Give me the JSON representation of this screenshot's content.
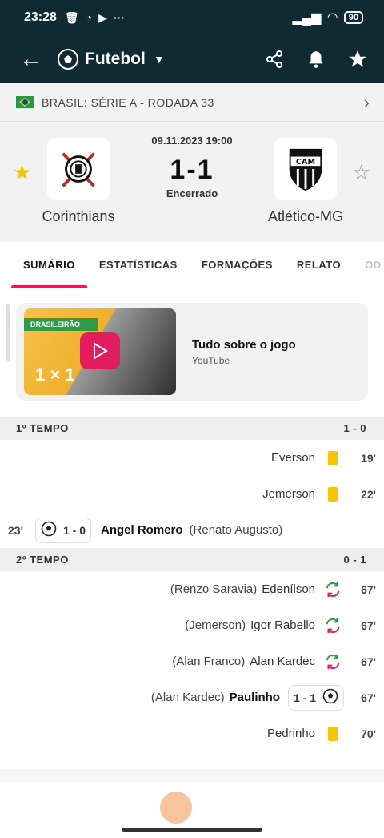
{
  "status": {
    "time": "23:28",
    "battery": "90"
  },
  "appbar": {
    "title": "Futebol"
  },
  "league": {
    "text": "BRASIL: SÉRIE A - RODADA 33"
  },
  "match": {
    "datetime": "09.11.2023 19:00",
    "score": "1-1",
    "state": "Encerrado",
    "home": "Corinthians",
    "away": "Atlético-MG"
  },
  "tabs": [
    "SUMÁRIO",
    "ESTATÍSTICAS",
    "FORMAÇÕES",
    "RELATO",
    "OD"
  ],
  "video": {
    "tag": "BRASILEIRÃO",
    "title": "Tudo sobre o jogo",
    "source": "YouTube",
    "thumb_score": "1 × 1"
  },
  "first_half": {
    "label": "1º TEMPO",
    "score": "1 - 0",
    "events": [
      {
        "player": "Everson",
        "minute": "19'",
        "type": "yellow-card"
      },
      {
        "player": "Jemerson",
        "minute": "22'",
        "type": "yellow-card"
      },
      {
        "minute": "23'",
        "score": "1 - 0",
        "player": "Angel Romero",
        "assist": "(Renato Augusto)",
        "type": "goal"
      }
    ]
  },
  "second_half": {
    "label": "2º TEMPO",
    "score": "0 - 1",
    "events": [
      {
        "out": "(Renzo Saravia)",
        "player": "Edenílson",
        "minute": "67'",
        "type": "substitution"
      },
      {
        "out": "(Jemerson)",
        "player": "Igor Rabello",
        "minute": "67'",
        "type": "substitution"
      },
      {
        "out": "(Alan Franco)",
        "player": "Alan Kardec",
        "minute": "67'",
        "type": "substitution"
      },
      {
        "assist": "(Alan Kardec)",
        "player": "Paulinho",
        "score": "1 - 1",
        "minute": "67'",
        "type": "goal"
      },
      {
        "player": "Pedrinho",
        "minute": "70'",
        "type": "yellow-card"
      }
    ]
  },
  "colors": {
    "header": "#0f2a33",
    "accent": "#e31c5f",
    "yellow": "#f7c600",
    "sub_green": "#2e9c46",
    "sub_red": "#e31c5f"
  }
}
